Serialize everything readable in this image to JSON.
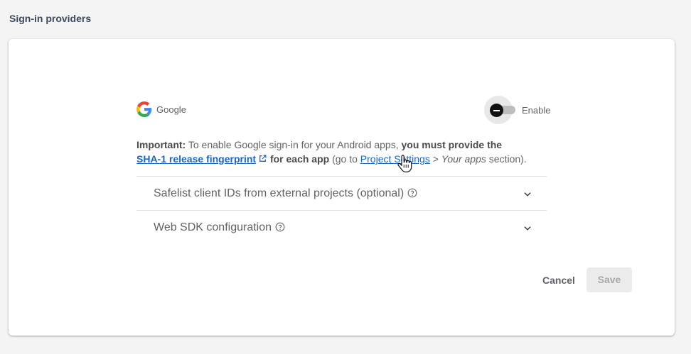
{
  "section_title": "Sign-in providers",
  "provider": {
    "name": "Google",
    "icon": "google-g-icon",
    "toggle_label": "Enable",
    "toggle_on": false
  },
  "info": {
    "important_label": "Important:",
    "text1": " To enable Google sign-in for your Android apps, ",
    "must_provide": "you must provide the",
    "fingerprint_link": "SHA-1 release fingerprint",
    "for_each_app": "for each app",
    "text2": " (go to ",
    "project_settings_link": "Project Settings",
    "text3": " > ",
    "your_apps": "Your apps",
    "text4": " section)."
  },
  "accordions": [
    {
      "label": "Safelist client IDs from external projects (optional)"
    },
    {
      "label": "Web SDK configuration"
    }
  ],
  "buttons": {
    "cancel": "Cancel",
    "save": "Save"
  },
  "colors": {
    "link": "#1a66c9",
    "background": "#f4f4f5",
    "card": "#ffffff"
  }
}
